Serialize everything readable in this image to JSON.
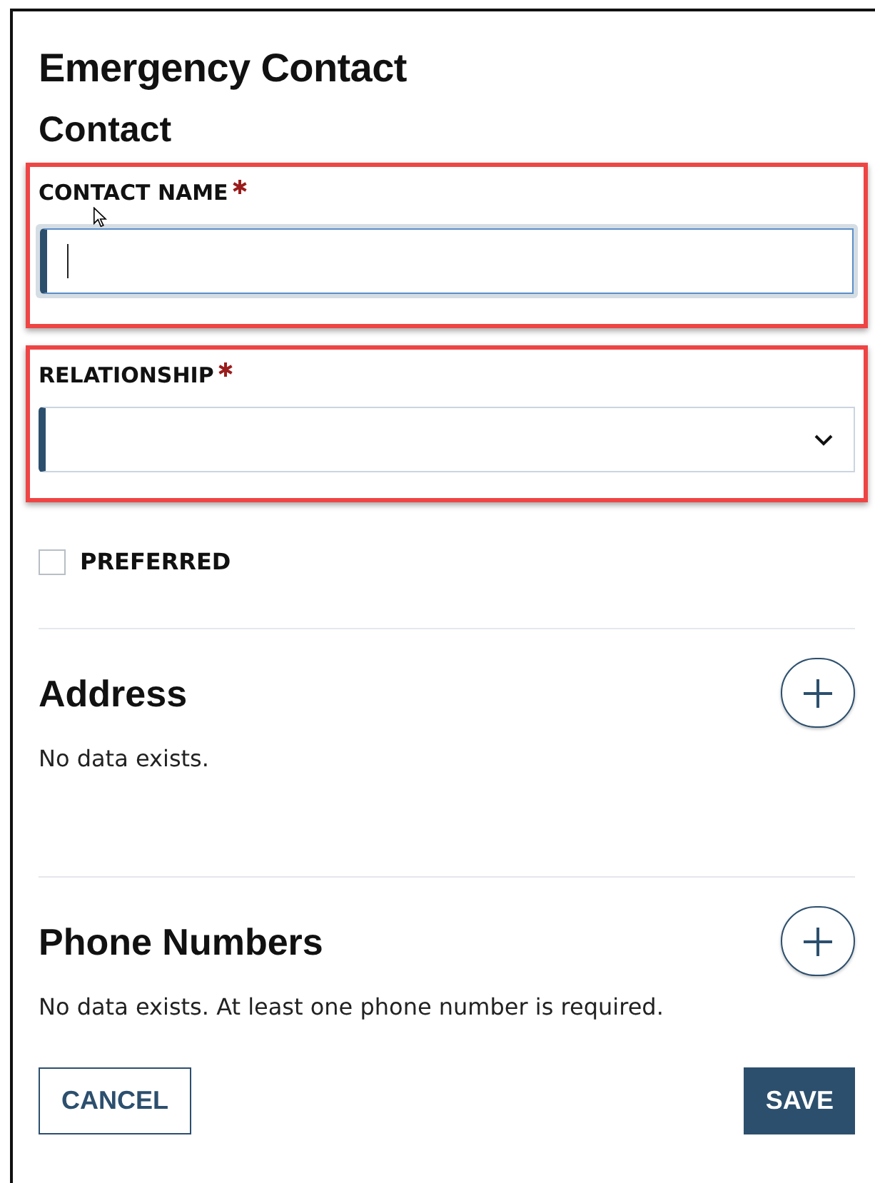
{
  "title": "Emergency Contact",
  "section_title": "Contact",
  "fields": [
    {
      "kind": "text",
      "label": "CONTACT NAME",
      "required": true,
      "focused": true,
      "highlighted": true
    },
    {
      "kind": "select",
      "label": "RELATIONSHIP",
      "required": true,
      "focused": false,
      "highlighted": true
    }
  ],
  "checkbox": {
    "label": "PREFERRED",
    "checked": false
  },
  "sections": [
    {
      "title": "Address",
      "message": "No data exists."
    },
    {
      "title": "Phone Numbers",
      "message": "No data exists. At least one phone number is required."
    }
  ],
  "buttons": [
    {
      "label": "CANCEL",
      "kind": "secondary"
    },
    {
      "label": "SAVE",
      "kind": "primary"
    }
  ]
}
